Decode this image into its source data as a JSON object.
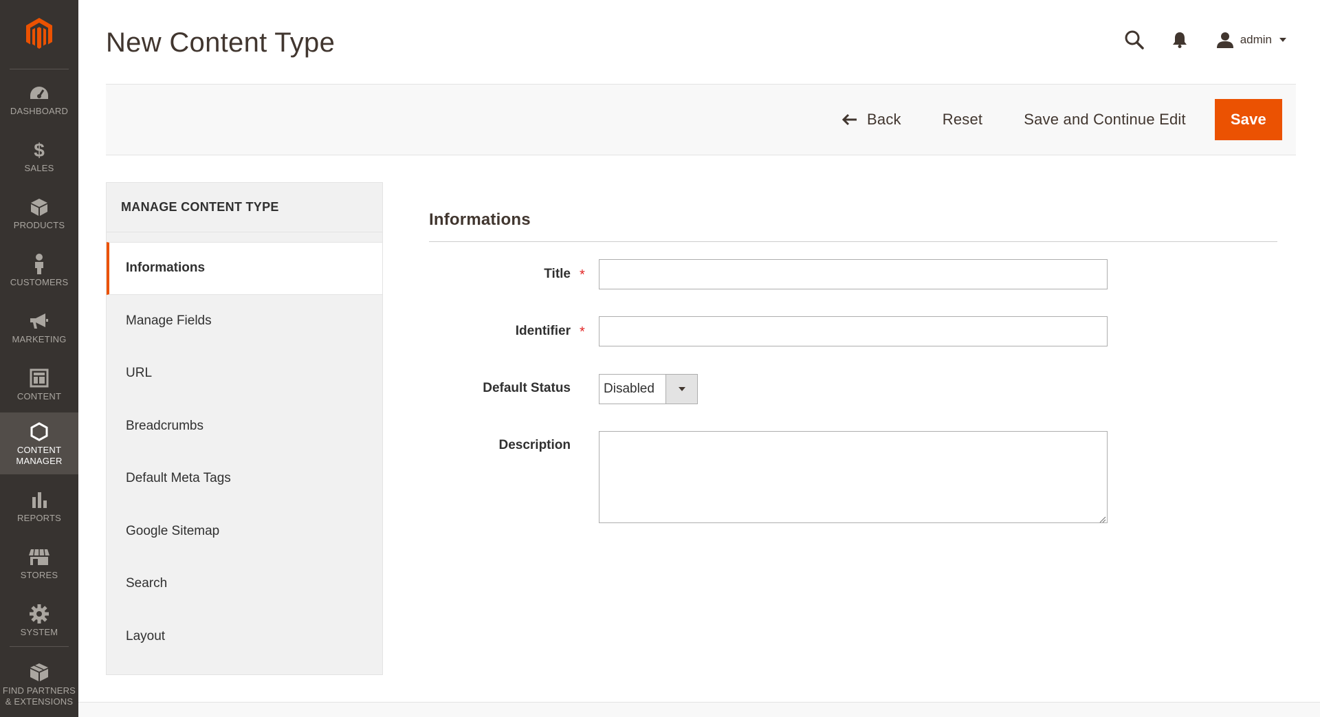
{
  "colors": {
    "accent": "#eb5202",
    "sidebar_bg": "#373330",
    "sidebar_active_bg": "#524d49",
    "required_star": "#e22626"
  },
  "sidebar": {
    "logo_icon": "magento-logo-icon",
    "items": [
      {
        "label": "DASHBOARD",
        "icon": "dashboard-gauge-icon",
        "active": false
      },
      {
        "label": "SALES",
        "icon": "dollar-icon",
        "active": false
      },
      {
        "label": "PRODUCTS",
        "icon": "box-icon",
        "active": false
      },
      {
        "label": "CUSTOMERS",
        "icon": "person-icon",
        "active": false
      },
      {
        "label": "MARKETING",
        "icon": "megaphone-icon",
        "active": false
      },
      {
        "label": "CONTENT",
        "icon": "layout-icon",
        "active": false
      },
      {
        "label": "CONTENT\nMANAGER",
        "icon": "hexagon-icon",
        "active": true
      },
      {
        "label": "REPORTS",
        "icon": "bar-chart-icon",
        "active": false
      },
      {
        "label": "STORES",
        "icon": "storefront-icon",
        "active": false
      },
      {
        "label": "SYSTEM",
        "icon": "gear-icon",
        "active": false
      },
      {
        "label": "FIND PARTNERS\n& EXTENSIONS",
        "icon": "extensions-box-icon",
        "active": false
      }
    ]
  },
  "header": {
    "title": "New Content Type",
    "user_name": "admin"
  },
  "actionbar": {
    "back_label": "Back",
    "reset_label": "Reset",
    "save_continue_label": "Save and Continue Edit",
    "save_label": "Save"
  },
  "tabs": {
    "title": "MANAGE CONTENT TYPE",
    "items": [
      {
        "label": "Informations",
        "active": true
      },
      {
        "label": "Manage Fields",
        "active": false
      },
      {
        "label": "URL",
        "active": false
      },
      {
        "label": "Breadcrumbs",
        "active": false
      },
      {
        "label": "Default Meta Tags",
        "active": false
      },
      {
        "label": "Google Sitemap",
        "active": false
      },
      {
        "label": "Search",
        "active": false
      },
      {
        "label": "Layout",
        "active": false
      }
    ]
  },
  "form": {
    "section_title": "Informations",
    "title_label": "Title",
    "title_value": "",
    "identifier_label": "Identifier",
    "identifier_value": "",
    "status_label": "Default Status",
    "status_value": "Disabled",
    "description_label": "Description",
    "description_value": "",
    "required_mark": "*"
  }
}
